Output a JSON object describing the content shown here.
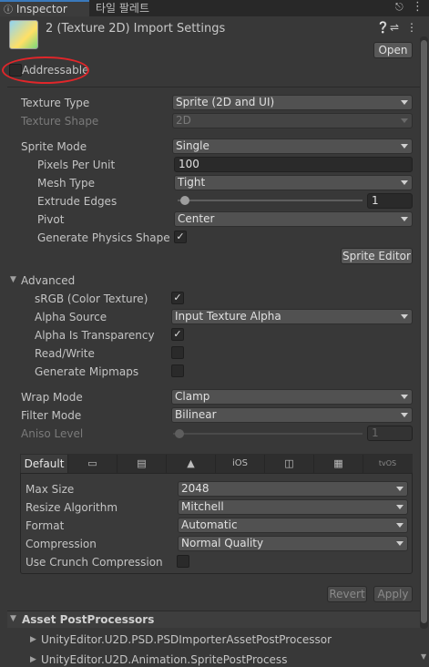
{
  "tabs": {
    "inspector": "Inspector",
    "tile_palette": "타일 팔레트"
  },
  "header": {
    "title": "2 (Texture 2D) Import Settings",
    "open_label": "Open"
  },
  "addressable": {
    "label": "Addressable",
    "checked": false
  },
  "texture": {
    "type_label": "Texture Type",
    "type_value": "Sprite (2D and UI)",
    "shape_label": "Texture Shape",
    "shape_value": "2D",
    "sprite_mode_label": "Sprite Mode",
    "sprite_mode_value": "Single",
    "ppu_label": "Pixels Per Unit",
    "ppu_value": "100",
    "mesh_type_label": "Mesh Type",
    "mesh_type_value": "Tight",
    "extrude_label": "Extrude Edges",
    "extrude_value": "1",
    "pivot_label": "Pivot",
    "pivot_value": "Center",
    "gen_physics_label": "Generate Physics Shape",
    "sprite_editor_label": "Sprite Editor"
  },
  "advanced": {
    "header": "Advanced",
    "srgb_label": "sRGB (Color Texture)",
    "alpha_source_label": "Alpha Source",
    "alpha_source_value": "Input Texture Alpha",
    "alpha_transp_label": "Alpha Is Transparency",
    "readwrite_label": "Read/Write",
    "mipmaps_label": "Generate Mipmaps"
  },
  "wrap": {
    "wrap_label": "Wrap Mode",
    "wrap_value": "Clamp",
    "filter_label": "Filter Mode",
    "filter_value": "Bilinear",
    "aniso_label": "Aniso Level",
    "aniso_value": "1"
  },
  "platform": {
    "tabs": [
      "Default",
      "iOS",
      "tvOS"
    ],
    "max_size_label": "Max Size",
    "max_size_value": "2048",
    "resize_label": "Resize Algorithm",
    "resize_value": "Mitchell",
    "format_label": "Format",
    "format_value": "Automatic",
    "compression_label": "Compression",
    "compression_value": "Normal Quality",
    "crunch_label": "Use Crunch Compression"
  },
  "actions": {
    "revert": "Revert",
    "apply": "Apply"
  },
  "postprocessors": {
    "header": "Asset PostProcessors",
    "items": [
      "UnityEditor.U2D.PSD.PSDImporterAssetPostProcessor",
      "UnityEditor.U2D.Animation.SpritePostProcess"
    ]
  },
  "colors": {
    "accent": "#3a79bb",
    "highlight_ring": "#e0262a"
  }
}
